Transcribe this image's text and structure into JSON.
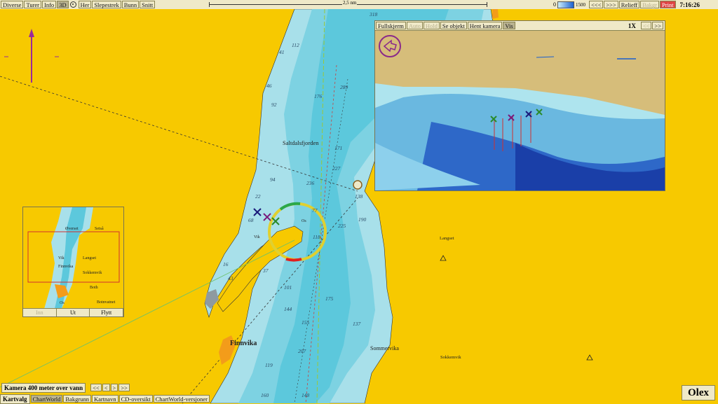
{
  "menu": {
    "left": [
      "Diverse",
      "Turer",
      "Info",
      "3D",
      "Her",
      "Slepestrek",
      "Bunn",
      "Snitt"
    ],
    "scale_label": "2,5 nm",
    "depth_min": "0",
    "depth_max": "1500",
    "nav_back": "<<<",
    "nav_fwd": ">>>",
    "relieff": "Relieff",
    "bakgr": "Bakgr",
    "print": "Print",
    "clock": "7:16:26"
  },
  "view3d": {
    "toolbar": [
      "Fullskjerm",
      "Auto",
      "Hold",
      "Se objekt",
      "Hent kamera",
      "Vis"
    ],
    "zoom": "1X",
    "prev": "<<",
    "next": ">>"
  },
  "minimap": {
    "labels": [
      "Øverset",
      "Setså",
      "Langset",
      "Sokkemvik",
      "Both",
      "Botnvatnet",
      "Os",
      "Vik",
      "Finnvika"
    ],
    "buttons": [
      "Inn",
      "Ut",
      "Flytt"
    ]
  },
  "camera": {
    "label": "Kamera 400 meter over vann",
    "buttons": [
      "<<",
      "<",
      ">",
      ">>"
    ]
  },
  "bottom": {
    "kartvalg": "Kartvalg",
    "tabs": [
      "ChartWorld",
      "Bakgrunn",
      "Kartnavn",
      "CD-oversikt",
      "ChartWorld-versjoner"
    ]
  },
  "logo": "Olex",
  "places": {
    "saltdalsfjorden": "Saltdalsfjorden",
    "finnvika": "Finnvika",
    "sommervika": "Sommervika",
    "langset": "Langset",
    "sokkemvik": "Sokkemvik",
    "vik": "Vik",
    "os": "Os"
  },
  "depths": [
    "312",
    "112",
    "41",
    "46",
    "176",
    "92",
    "289",
    "171",
    "227",
    "236",
    "94",
    "22",
    "77",
    "118",
    "138",
    "190",
    "225",
    "68",
    "16",
    "37",
    "43",
    "101",
    "175",
    "144",
    "155",
    "207",
    "119",
    "137",
    "160",
    "148",
    "27",
    "318"
  ],
  "colors": {
    "land": "#f7c900",
    "shallow": "#a8e0ea",
    "deep": "#5cc8dc",
    "deepest": "#3db4d0",
    "toolbar": "#efe9c8"
  }
}
